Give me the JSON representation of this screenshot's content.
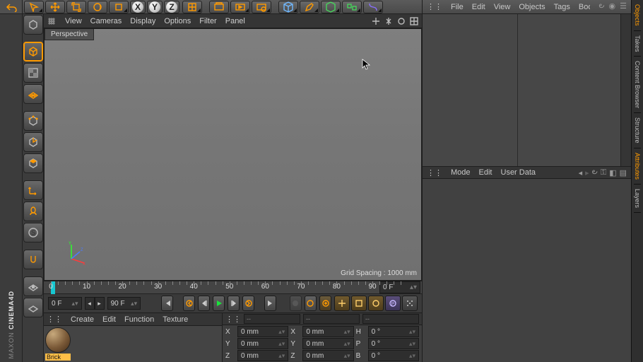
{
  "topToolbar": {
    "axes": [
      "X",
      "Y",
      "Z"
    ]
  },
  "viewportMenus": [
    "View",
    "Cameras",
    "Display",
    "Options",
    "Filter",
    "Panel"
  ],
  "viewportTab": "Perspective",
  "gridSpacing": "Grid Spacing : 1000 mm",
  "timeline": {
    "ticks": [
      0,
      10,
      20,
      30,
      40,
      50,
      60,
      70,
      80,
      90
    ],
    "endField": "0 F",
    "startField": "0 F",
    "rangeEndField": "90 F"
  },
  "materialMenus": [
    "Create",
    "Edit",
    "Function",
    "Texture"
  ],
  "material": {
    "name": "Brick"
  },
  "coords": {
    "dropdowns": [
      "--",
      "--",
      "--"
    ],
    "rows": [
      {
        "a": "X",
        "av": "0 mm",
        "b": "X",
        "bv": "0 mm",
        "c": "H",
        "cv": "0 °"
      },
      {
        "a": "Y",
        "av": "0 mm",
        "b": "Y",
        "bv": "0 mm",
        "c": "P",
        "cv": "0 °"
      },
      {
        "a": "Z",
        "av": "0 mm",
        "b": "Z",
        "bv": "0 mm",
        "c": "B",
        "cv": "0 °"
      }
    ]
  },
  "objectsMenus": [
    "File",
    "Edit",
    "View",
    "Objects",
    "Tags",
    "Bookmarks"
  ],
  "attrMenus": [
    "Mode",
    "Edit",
    "User Data"
  ],
  "sideTabs": [
    {
      "label": "Objects",
      "accent": true
    },
    {
      "label": "Takes",
      "accent": false
    },
    {
      "label": "Content Browser",
      "accent": false
    },
    {
      "label": "Structure",
      "accent": false
    },
    {
      "label": "Attributes",
      "accent": true
    },
    {
      "label": "Layers",
      "accent": false
    }
  ],
  "brand": {
    "top": "MAXON",
    "bottom": "CINEMA4D"
  }
}
